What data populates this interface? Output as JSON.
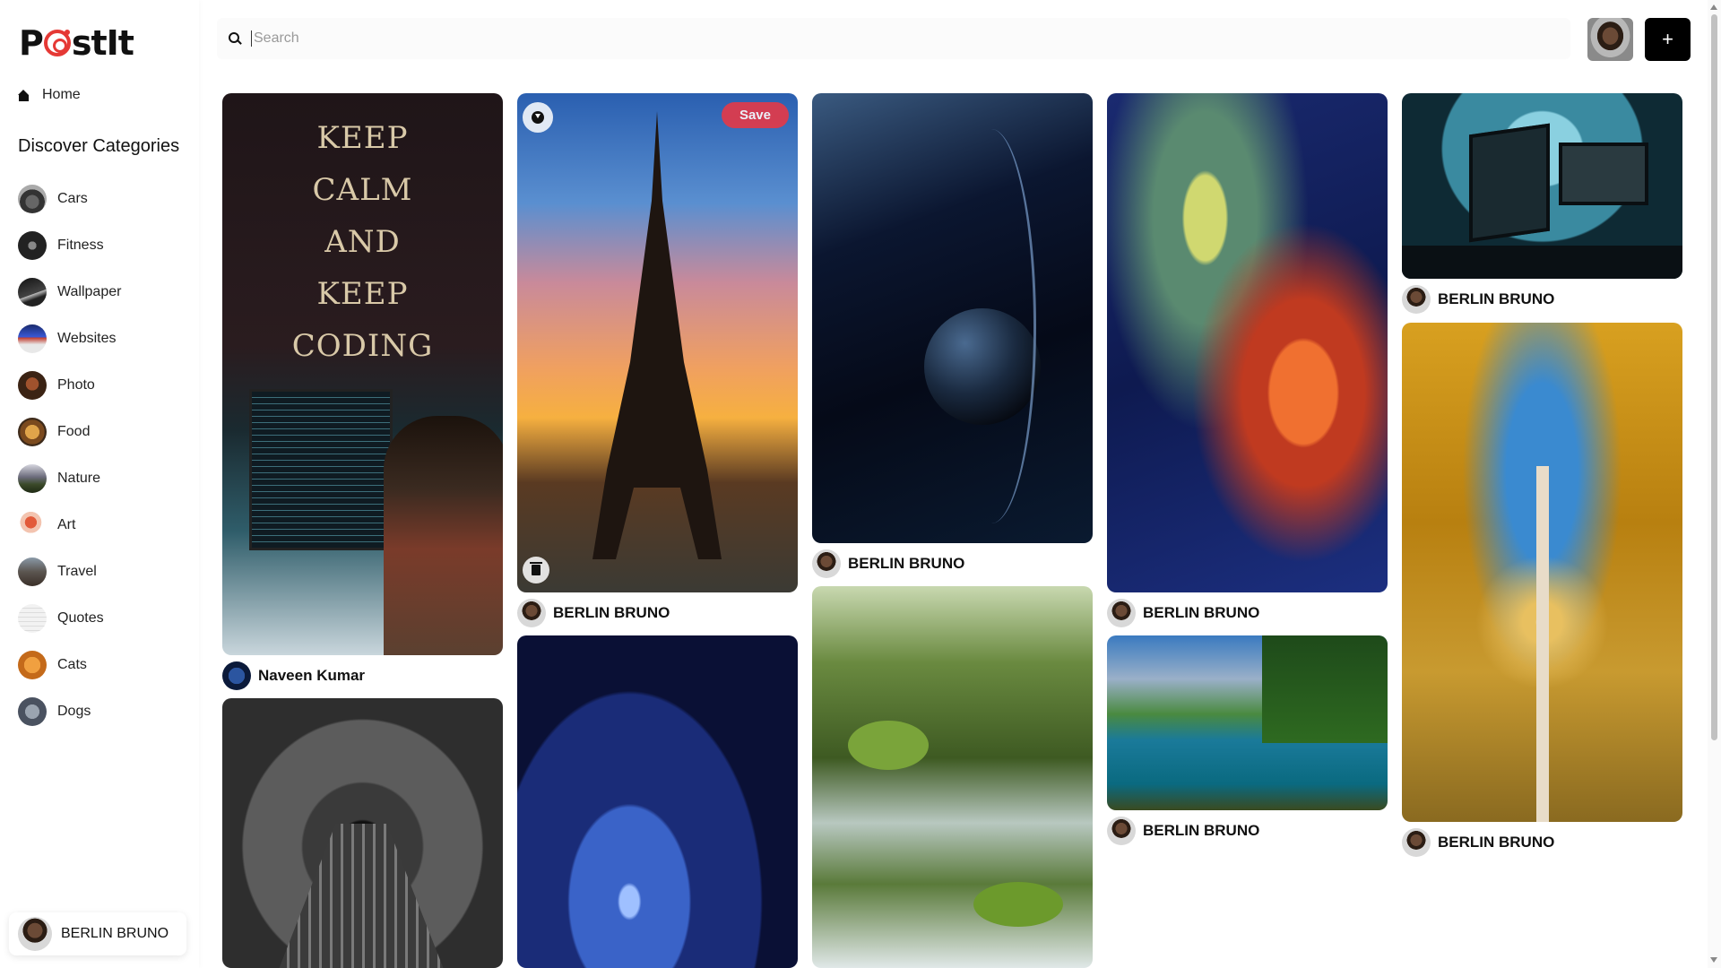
{
  "app": {
    "logo_text_left": "P",
    "logo_text_right": "stIt"
  },
  "sidebar": {
    "home_label": "Home",
    "categories_heading": "Discover Categories",
    "categories": [
      {
        "label": "Cars",
        "icon": "cars-thumb"
      },
      {
        "label": "Fitness",
        "icon": "fitness-thumb"
      },
      {
        "label": "Wallpaper",
        "icon": "wallpaper-thumb"
      },
      {
        "label": "Websites",
        "icon": "websites-thumb"
      },
      {
        "label": "Photo",
        "icon": "photo-thumb"
      },
      {
        "label": "Food",
        "icon": "food-thumb"
      },
      {
        "label": "Nature",
        "icon": "nature-thumb"
      },
      {
        "label": "Art",
        "icon": "art-thumb"
      },
      {
        "label": "Travel",
        "icon": "travel-thumb"
      },
      {
        "label": "Quotes",
        "icon": "quotes-thumb"
      },
      {
        "label": "Cats",
        "icon": "cats-thumb"
      },
      {
        "label": "Dogs",
        "icon": "dogs-thumb"
      }
    ],
    "user_name": "BERLIN BRUNO"
  },
  "header": {
    "search_placeholder": "Search",
    "add_label": "+"
  },
  "pins": {
    "coding": {
      "author": "Naveen Kumar",
      "overlay": [
        "KEEP",
        "CALM",
        "AND",
        "KEEP",
        "CODING"
      ]
    },
    "eiffel": {
      "author": "BERLIN BRUNO",
      "save_label": "Save"
    },
    "planet": {
      "author": "BERLIN BRUNO"
    },
    "nebula": {
      "author": "BERLIN BRUNO"
    },
    "desk": {
      "author": "BERLIN BRUNO"
    },
    "lake": {
      "author": "BERLIN BRUNO"
    },
    "trees": {
      "author": "BERLIN BRUNO"
    },
    "bridge": {
      "author": ""
    },
    "abstract": {
      "author": ""
    },
    "stream": {
      "author": ""
    }
  },
  "colors": {
    "brand": "#e53935",
    "save_button": "#e53947",
    "add_button": "#000000"
  }
}
